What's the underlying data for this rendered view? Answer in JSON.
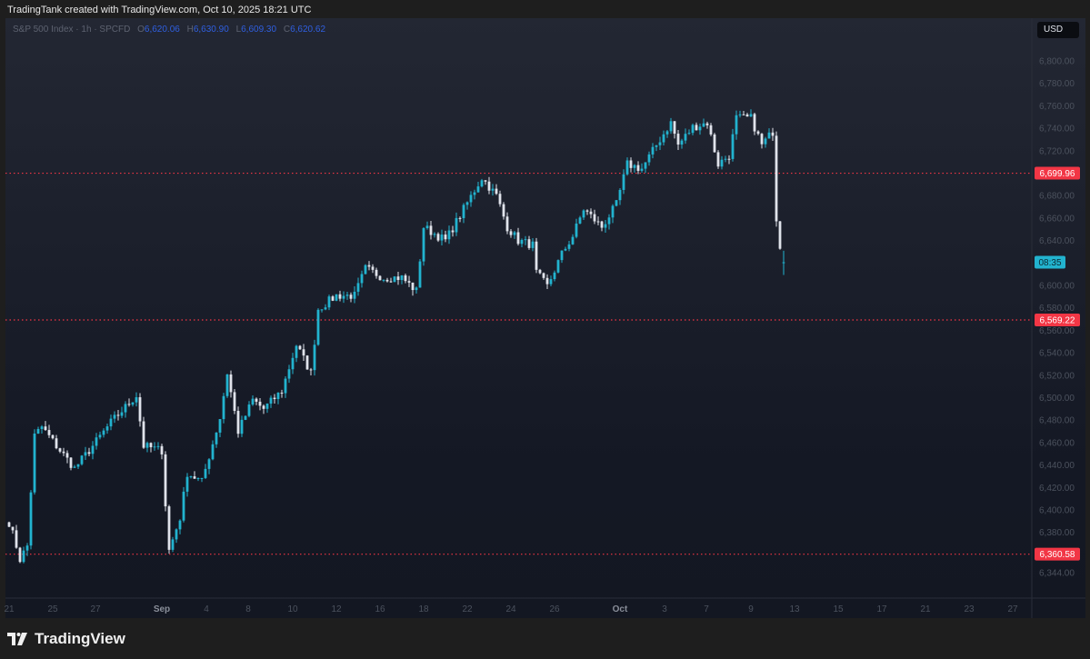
{
  "header": {
    "title": "TradingTank created with TradingView.com, Oct 10, 2025 18:21 UTC"
  },
  "legend": {
    "symbol": "S&P 500 Index · 1h · SPCFD",
    "o_label": "O",
    "o": "6,620.06",
    "h_label": "H",
    "h": "6,630.90",
    "l_label": "L",
    "l": "6,609.30",
    "c_label": "C",
    "c": "6,620.62"
  },
  "currency": "USD",
  "footer": {
    "brand": "TradingView"
  },
  "colors": {
    "up": "#22b3cf",
    "down": "#e0e3eb",
    "level": "#f23645",
    "countdown": "#22b3cf"
  },
  "chart_data": {
    "type": "candlestick",
    "title": "S&P 500 Index · 1h · SPCFD",
    "ylim": [
      6335,
      6815
    ],
    "y_ticks": [
      "6,800.00",
      "6,780.00",
      "6,760.00",
      "6,740.00",
      "6,720.00",
      "6,680.00",
      "6,660.00",
      "6,640.00",
      "6,600.00",
      "6,580.00",
      "6,560.00",
      "6,540.00",
      "6,520.00",
      "6,500.00",
      "6,480.00",
      "6,460.00",
      "6,440.00",
      "6,420.00",
      "6,400.00",
      "6,380.00",
      "6,344.00"
    ],
    "x_ticks": [
      "21",
      "25",
      "27",
      "Sep",
      "4",
      "8",
      "10",
      "12",
      "16",
      "18",
      "22",
      "24",
      "26",
      "Oct",
      "3",
      "7",
      "9",
      "13",
      "15",
      "17",
      "21",
      "23",
      "27"
    ],
    "levels": [
      {
        "value": 6699.96,
        "label": "6,699.96"
      },
      {
        "value": 6569.22,
        "label": "6,569.22"
      },
      {
        "value": 6360.58,
        "label": "6,360.58"
      }
    ],
    "countdown": {
      "label": "08:35",
      "value": 6620.62
    },
    "price_path": [
      [
        0,
        6389
      ],
      [
        2,
        6368
      ],
      [
        3,
        6356
      ],
      [
        5,
        6368
      ],
      [
        7,
        6466
      ],
      [
        9,
        6474
      ],
      [
        13,
        6457
      ],
      [
        18,
        6437
      ],
      [
        23,
        6457
      ],
      [
        28,
        6478
      ],
      [
        35,
        6502
      ],
      [
        37,
        6457
      ],
      [
        42,
        6453
      ],
      [
        43,
        6405
      ],
      [
        44,
        6364
      ],
      [
        47,
        6393
      ],
      [
        49,
        6433
      ],
      [
        53,
        6425
      ],
      [
        58,
        6482
      ],
      [
        60,
        6522
      ],
      [
        63,
        6470
      ],
      [
        67,
        6498
      ],
      [
        70,
        6490
      ],
      [
        75,
        6506
      ],
      [
        79,
        6547
      ],
      [
        83,
        6522
      ],
      [
        85,
        6579
      ],
      [
        90,
        6591
      ],
      [
        95,
        6591
      ],
      [
        98,
        6615
      ],
      [
        103,
        6607
      ],
      [
        108,
        6607
      ],
      [
        112,
        6595
      ],
      [
        114,
        6652
      ],
      [
        120,
        6640
      ],
      [
        125,
        6668
      ],
      [
        130,
        6696
      ],
      [
        134,
        6680
      ],
      [
        137,
        6652
      ],
      [
        140,
        6640
      ],
      [
        144,
        6636
      ],
      [
        145,
        6611
      ],
      [
        148,
        6599
      ],
      [
        152,
        6628
      ],
      [
        155,
        6644
      ],
      [
        158,
        6668
      ],
      [
        163,
        6652
      ],
      [
        167,
        6672
      ],
      [
        170,
        6708
      ],
      [
        174,
        6704
      ],
      [
        178,
        6725
      ],
      [
        182,
        6745
      ],
      [
        184,
        6725
      ],
      [
        188,
        6741
      ],
      [
        192,
        6745
      ],
      [
        195,
        6708
      ],
      [
        198,
        6716
      ],
      [
        200,
        6749
      ],
      [
        204,
        6749
      ],
      [
        207,
        6725
      ],
      [
        210,
        6737
      ],
      [
        211,
        6660
      ],
      [
        212,
        6636
      ],
      [
        213,
        6620.62
      ]
    ],
    "last_bar": {
      "open": 6620.06,
      "high": 6630.9,
      "low": 6609.3,
      "close": 6620.62
    }
  }
}
